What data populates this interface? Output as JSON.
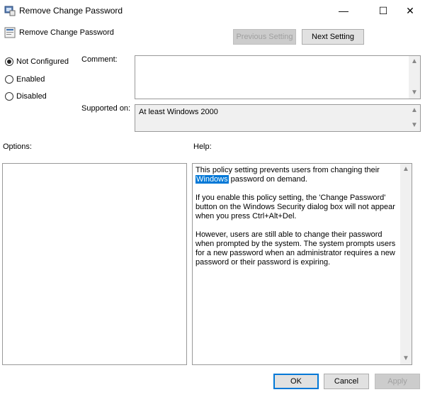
{
  "window": {
    "title": "Remove Change Password",
    "icon": "policy-icon",
    "controls": {
      "minimize": "—",
      "maximize": "☐",
      "close": "✕"
    }
  },
  "header": {
    "title": "Remove Change Password",
    "icon": "policy-icon",
    "prev_label": "Previous Setting",
    "next_label": "Next Setting"
  },
  "state": {
    "options": [
      {
        "label": "Not Configured",
        "checked": true
      },
      {
        "label": "Enabled",
        "checked": false
      },
      {
        "label": "Disabled",
        "checked": false
      }
    ]
  },
  "comment": {
    "label": "Comment:",
    "value": ""
  },
  "supported": {
    "label": "Supported on:",
    "value": "At least Windows 2000"
  },
  "options_panel": {
    "label": "Options:"
  },
  "help": {
    "label": "Help:",
    "p1_before": "This policy setting prevents users from changing their ",
    "p1_highlight": "Windows",
    "p1_after": " password on demand.",
    "p2": "If you enable this policy setting,  the 'Change Password' button on the Windows Security dialog box will not appear when you press Ctrl+Alt+Del.",
    "p3": "However, users are still able to change their password when prompted by the system. The system prompts users for a new password when an administrator requires a new password or their password is expiring."
  },
  "footer": {
    "ok_label": "OK",
    "cancel_label": "Cancel",
    "apply_label": "Apply"
  },
  "colors": {
    "accent": "#0078d7"
  }
}
